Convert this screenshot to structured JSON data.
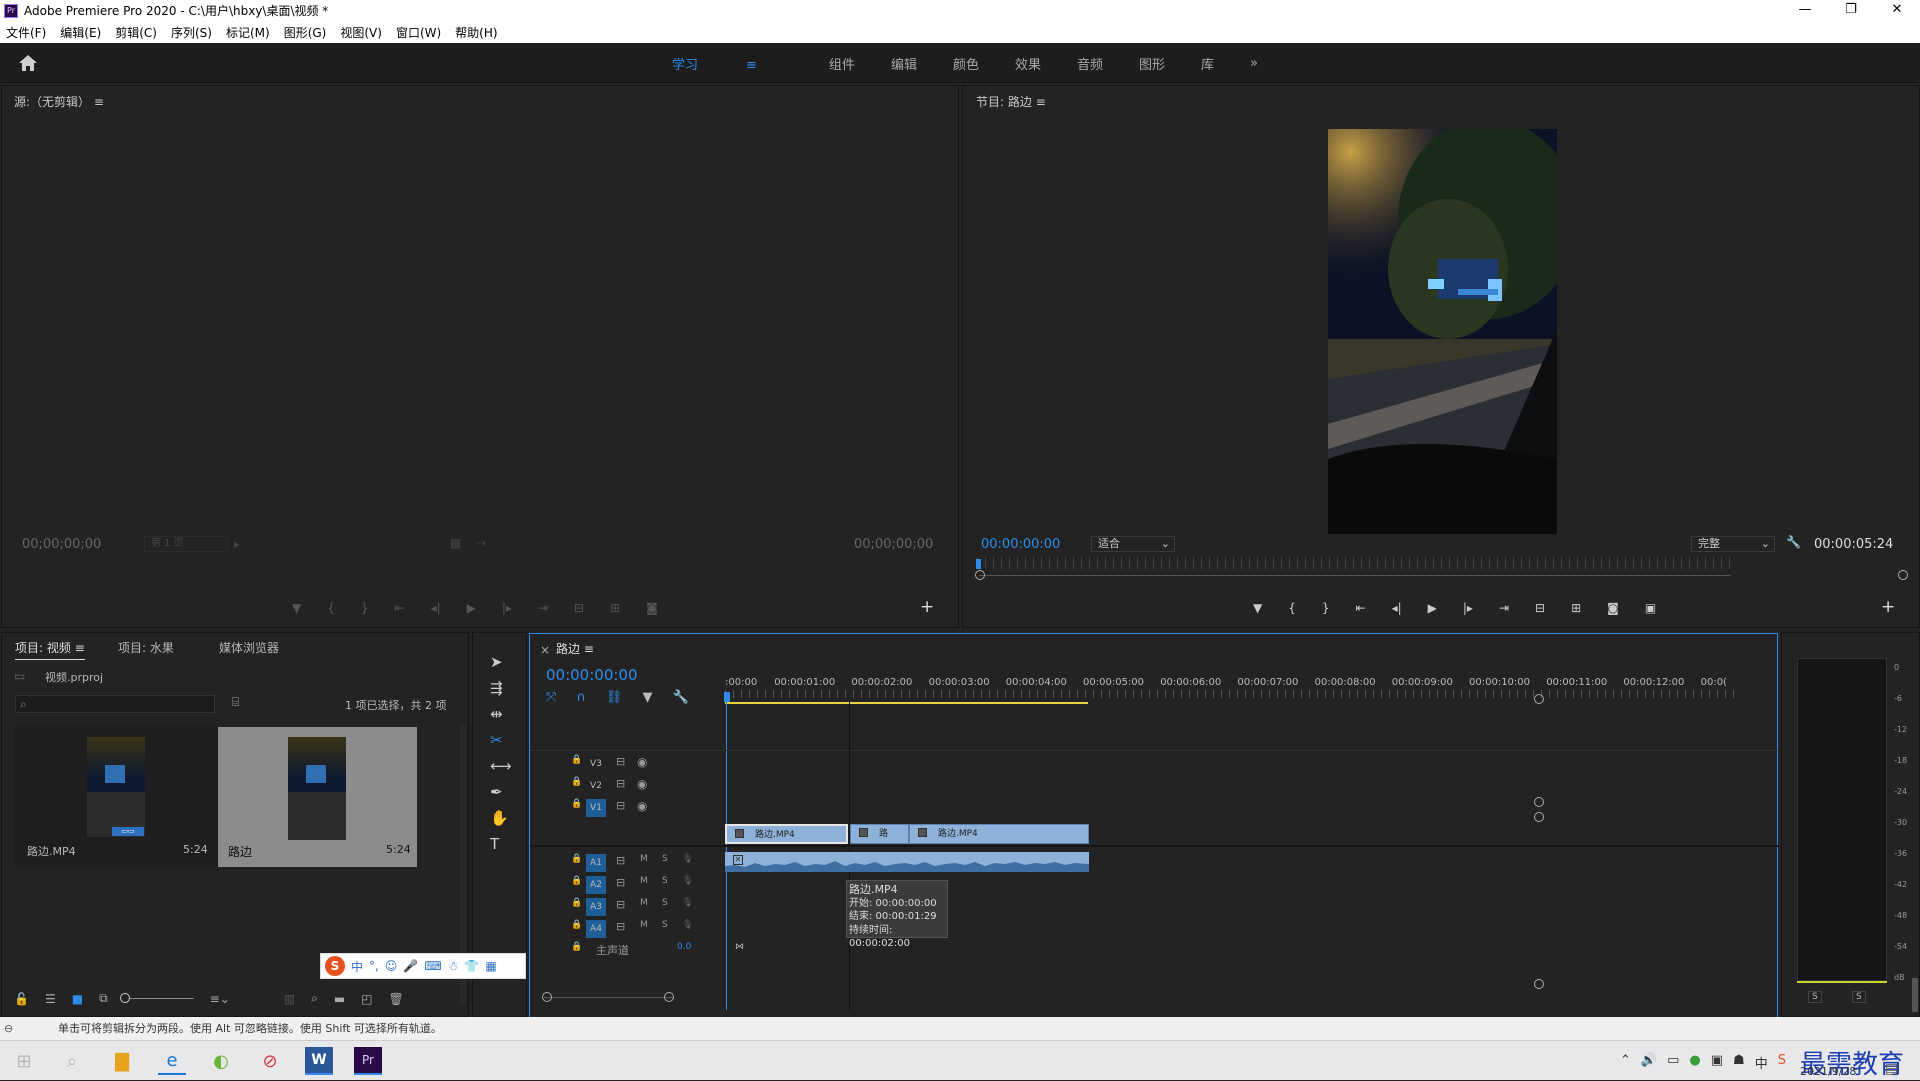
{
  "window": {
    "app_icon": "Pr",
    "title": "Adobe Premiere Pro 2020 - C:\\用户\\hbxy\\桌面\\视频 *",
    "controls": [
      "—",
      "❐",
      "✕"
    ]
  },
  "menu": [
    "文件(F)",
    "编辑(E)",
    "剪辑(C)",
    "序列(S)",
    "标记(M)",
    "图形(G)",
    "视图(V)",
    "窗口(W)",
    "帮助(H)"
  ],
  "workspaces": {
    "items": [
      "学习",
      "组件",
      "编辑",
      "颜色",
      "效果",
      "音频",
      "图形",
      "库"
    ],
    "active": "学习",
    "menu_icon": "≡",
    "more": "»"
  },
  "source": {
    "title": "源:（无剪辑）",
    "menu_icon": "≡",
    "timecode_left": "00;00;00;00",
    "page": "第 1 页",
    "timecode_right": "00;00;00;00"
  },
  "program": {
    "title": "节目: 路边",
    "menu_icon": "≡",
    "timecode_left": "00:00:00:00",
    "zoom": "适合",
    "quality": "完整",
    "timecode_right": "00:00:05:24"
  },
  "project": {
    "tabs": [
      "项目: 视频",
      "项目: 水果",
      "媒体浏览器"
    ],
    "active_tab": "项目: 视频",
    "file": "视频.prproj",
    "search_placeholder": "",
    "selection": "1 项已选择，共 2 项",
    "items": [
      {
        "name": "路边.MP4",
        "duration": "5:24",
        "selected": false
      },
      {
        "name": "路边",
        "duration": "5:24",
        "selected": true
      }
    ]
  },
  "timeline": {
    "sequence": "路边",
    "menu_icon": "≡",
    "close_icon": "×",
    "timecode": "00:00:00:00",
    "ruler": [
      ":00:00",
      "00:00:01:00",
      "00:00:02:00",
      "00:00:03:00",
      "00:00:04:00",
      "00:00:05:00",
      "00:00:06:00",
      "00:00:07:00",
      "00:00:08:00",
      "00:00:09:00",
      "00:00:10:00",
      "00:00:11:00",
      "00:00:12:00",
      "00:0("
    ],
    "video_tracks": [
      "V3",
      "V2",
      "V1"
    ],
    "audio_tracks": [
      "A1",
      "A2",
      "A3",
      "A4"
    ],
    "mute_label": "M",
    "solo_label": "S",
    "master": {
      "label": "主声道",
      "value": "0.0"
    },
    "clips": [
      "路边.MP4",
      "路边.MP",
      "路边.MP4"
    ],
    "tooltip": {
      "name": "路边.MP4",
      "start": "开始: 00:00:00:00",
      "end": "结束: 00:00:01:29",
      "duration": "持续时间: 00:00:02:00"
    }
  },
  "meter": {
    "scale": [
      "0",
      "-6",
      "-12",
      "-18",
      "-24",
      "-30",
      "-36",
      "-42",
      "-48",
      "-54",
      "dB"
    ],
    "solo_labels": [
      "S",
      "S"
    ]
  },
  "ime": {
    "chars": [
      "中",
      "°,"
    ]
  },
  "statusbar": "单击可将剪辑拆分为两段。使用 Alt 可忽略链接。使用 Shift 可选择所有轨道。",
  "taskbar": {
    "date": "2021/9/28",
    "watermark": "最需教育",
    "lang": "中"
  }
}
